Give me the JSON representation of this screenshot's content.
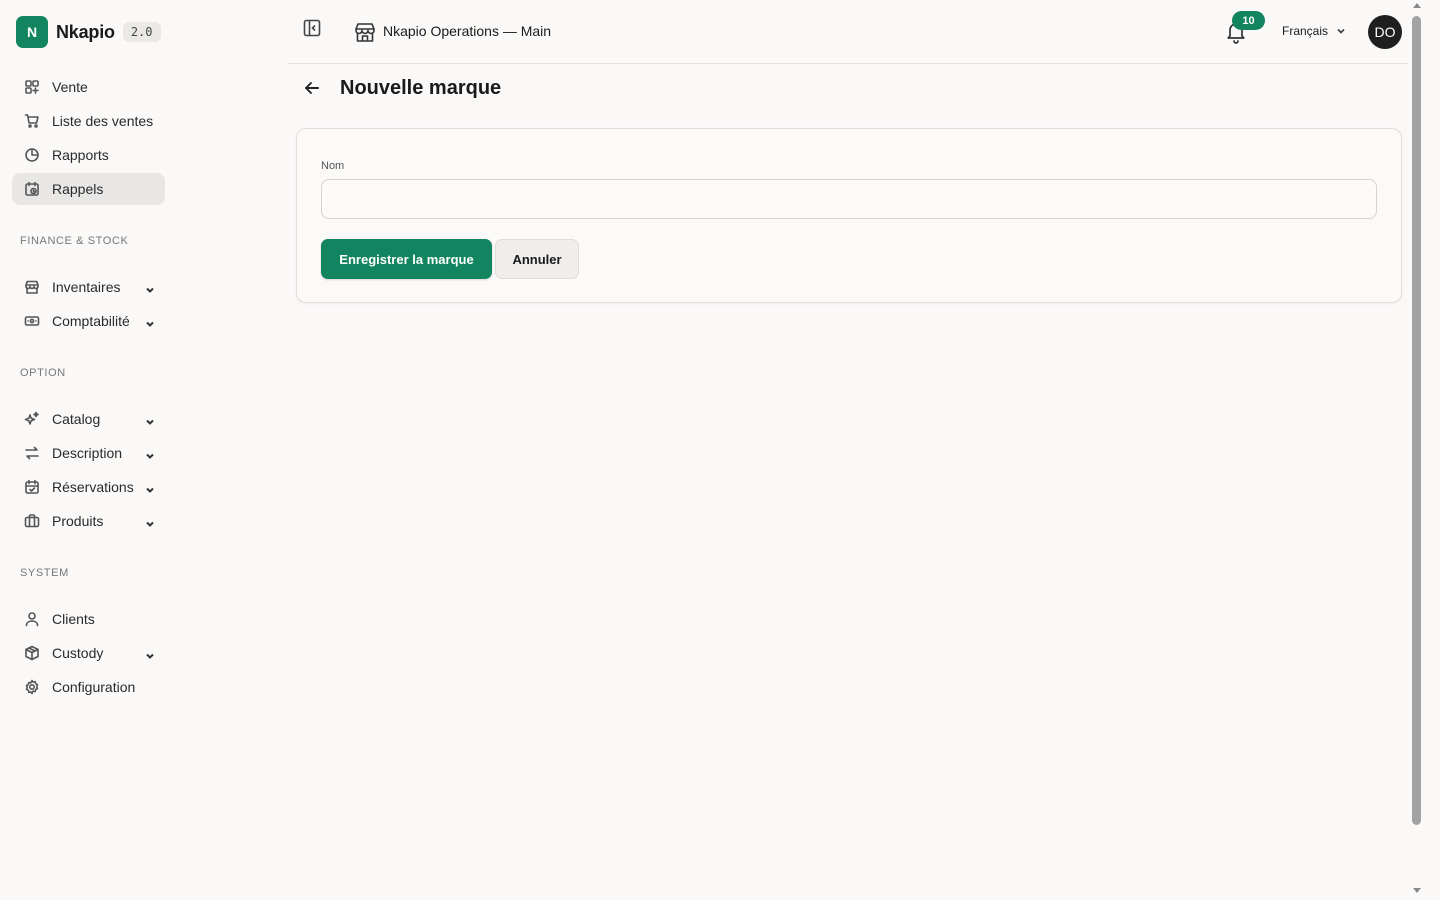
{
  "brand": {
    "logo_letter": "N",
    "name": "Nkapio",
    "version": "2.0"
  },
  "sidebar": {
    "main_items": [
      {
        "label": "Vente",
        "icon": "grid-plus-icon"
      },
      {
        "label": "Liste des ventes",
        "icon": "cart-icon"
      },
      {
        "label": "Rapports",
        "icon": "pie-chart-icon"
      },
      {
        "label": "Rappels",
        "icon": "calendar-clock-icon",
        "active": true
      }
    ],
    "sections": [
      {
        "title": "FINANCE & STOCK",
        "items": [
          {
            "label": "Inventaires",
            "icon": "store-icon",
            "expandable": true
          },
          {
            "label": "Comptabilité",
            "icon": "banknote-icon",
            "expandable": true
          }
        ]
      },
      {
        "title": "OPTION",
        "items": [
          {
            "label": "Catalog",
            "icon": "sparkles-icon",
            "expandable": true
          },
          {
            "label": "Description",
            "icon": "arrows-exchange-icon",
            "expandable": true
          },
          {
            "label": "Réservations",
            "icon": "calendar-check-icon",
            "expandable": true
          },
          {
            "label": "Produits",
            "icon": "briefcase-icon",
            "expandable": true
          }
        ]
      },
      {
        "title": "SYSTEM",
        "items": [
          {
            "label": "Clients",
            "icon": "user-icon",
            "expandable": false
          },
          {
            "label": "Custody",
            "icon": "box-icon",
            "expandable": true
          },
          {
            "label": "Configuration",
            "icon": "gear-icon",
            "expandable": false
          }
        ]
      }
    ]
  },
  "header": {
    "store_name": "Nkapio Operations — Main",
    "notification_count": "10",
    "language": "Français",
    "avatar_initials": "DO"
  },
  "page": {
    "title": "Nouvelle marque",
    "form": {
      "name_label": "Nom",
      "name_value": "",
      "name_placeholder": "",
      "save_label": "Enregistrer la marque",
      "cancel_label": "Annuler"
    }
  },
  "colors": {
    "accent": "#12845f",
    "background": "#faf9f8",
    "active_nav": "#e8e7e5"
  }
}
